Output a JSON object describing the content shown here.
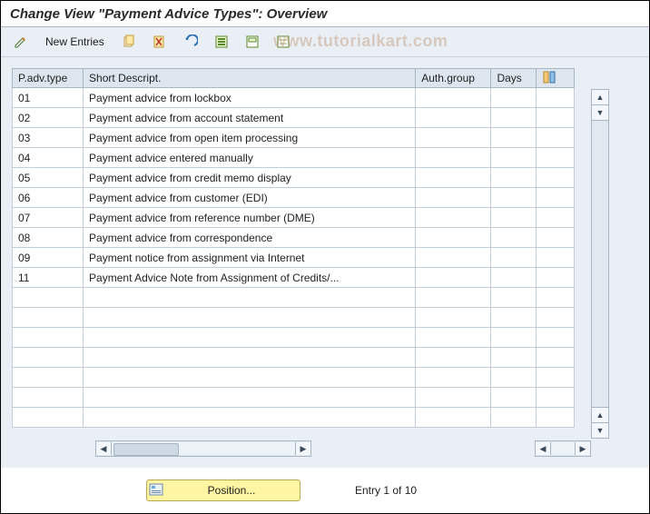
{
  "title": "Change View \"Payment Advice Types\": Overview",
  "watermark": "www.tutorialkart.com",
  "toolbar": {
    "new_entries_label": "New Entries"
  },
  "columns": {
    "type": "P.adv.type",
    "desc": "Short Descript.",
    "auth": "Auth.group",
    "days": "Days"
  },
  "rows": [
    {
      "type": "01",
      "desc": "Payment advice from lockbox",
      "auth": "",
      "days": ""
    },
    {
      "type": "02",
      "desc": "Payment advice from account statement",
      "auth": "",
      "days": ""
    },
    {
      "type": "03",
      "desc": "Payment advice from open item processing",
      "auth": "",
      "days": ""
    },
    {
      "type": "04",
      "desc": "Payment advice entered manually",
      "auth": "",
      "days": ""
    },
    {
      "type": "05",
      "desc": "Payment advice from credit memo display",
      "auth": "",
      "days": ""
    },
    {
      "type": "06",
      "desc": "Payment advice from customer (EDI)",
      "auth": "",
      "days": ""
    },
    {
      "type": "07",
      "desc": "Payment advice from reference number (DME)",
      "auth": "",
      "days": ""
    },
    {
      "type": "08",
      "desc": "Payment advice from correspondence",
      "auth": "",
      "days": ""
    },
    {
      "type": "09",
      "desc": "Payment notice from assignment via Internet",
      "auth": "",
      "days": ""
    },
    {
      "type": "11",
      "desc": "Payment Advice Note from Assignment of Credits/...",
      "auth": "",
      "days": ""
    }
  ],
  "empty_row_count": 7,
  "footer": {
    "position_label": "Position...",
    "entry_label": "Entry 1 of 10"
  }
}
